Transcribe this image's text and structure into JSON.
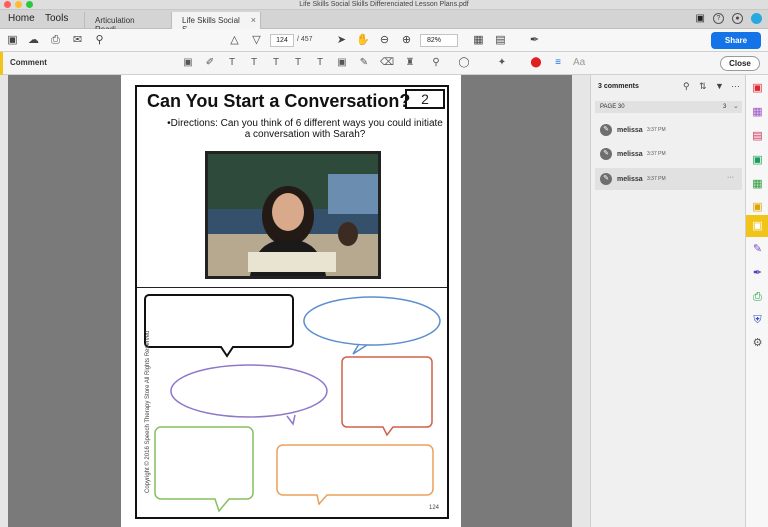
{
  "window": {
    "title": "Life Skills Social Skills Differenciated Lesson Plans.pdf"
  },
  "menu": {
    "home": "Home",
    "tools": "Tools"
  },
  "tabs": [
    {
      "label": "Articulation Readi..."
    },
    {
      "label": "Life Skills Social S...",
      "close": "×"
    }
  ],
  "toolbar": {
    "page_current": "124",
    "page_total": "/ 457",
    "zoom": "82%",
    "share_label": "Share"
  },
  "comment_bar": {
    "label": "Comment",
    "close_label": "Close"
  },
  "document": {
    "heading": "Can You Start a Conversation?",
    "number": "2",
    "directions": "•Directions: Can you think of 6 different ways you could initiate a conversation with Sarah?",
    "copyright": "Copyright © 2016 Speech Therapy Store All Rights Reserved",
    "page_number": "124"
  },
  "comments_pane": {
    "count_label": "3 comments",
    "page_label": "PAGE 30",
    "page_count": "3",
    "items": [
      {
        "author": "melissa",
        "time": "3:37 PM"
      },
      {
        "author": "melissa",
        "time": "3:37 PM"
      },
      {
        "author": "melissa",
        "time": "3:37 PM",
        "more": "···"
      }
    ]
  },
  "colors": {
    "share_blue": "#1473e6",
    "comment_accent": "#f0c419",
    "bubble_black": "#111111",
    "bubble_blue": "#5b8fd0",
    "bubble_purple": "#8e78c8",
    "bubble_red": "#d0614c",
    "bubble_green": "#86c05f",
    "bubble_orange": "#eba05a"
  }
}
